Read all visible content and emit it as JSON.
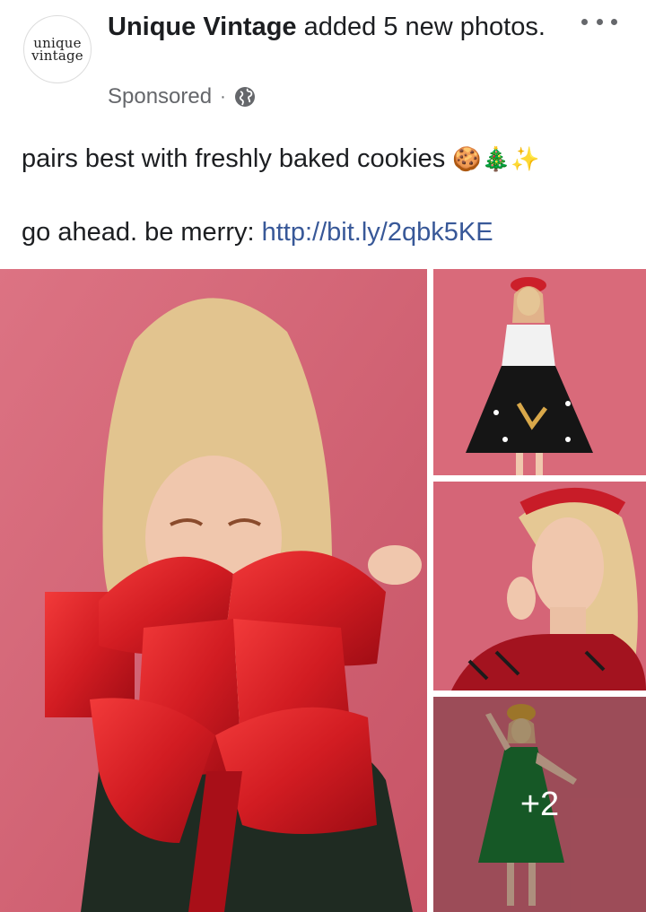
{
  "post": {
    "page_name": "Unique Vintage",
    "action_text": " added 5 new photos.",
    "avatar_line1": "unique",
    "avatar_line2": "vintage",
    "sponsored": "Sponsored",
    "separator": "·",
    "privacy_icon": "globe-icon",
    "more_icon": "more-options-icon"
  },
  "caption": {
    "line1": "pairs best with freshly baked cookies",
    "emoji": "🍪🎄✨",
    "line2_prefix": "go ahead. be merry: ",
    "link": "http://bit.ly/2qbk5KE"
  },
  "photos": {
    "count": 5,
    "visible": 4,
    "more_label": "+2"
  },
  "colors": {
    "link": "#385898",
    "secondary_text": "#65676b",
    "backdrop_pink": "#d96a7a"
  }
}
